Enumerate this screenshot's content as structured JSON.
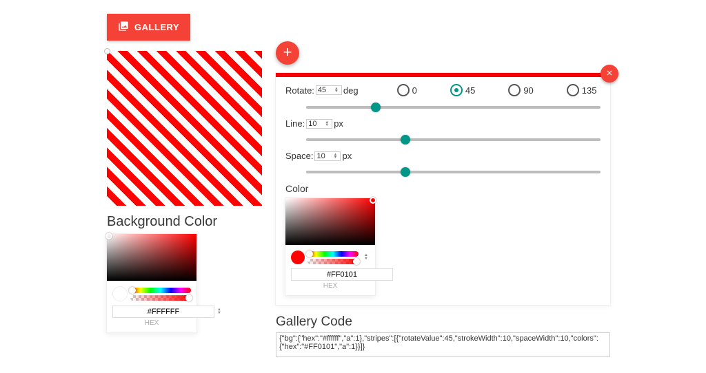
{
  "gallery_button_label": "GALLERY",
  "bg_section_title": "Background Color",
  "bg_hex": "#FFFFFF",
  "hex_label": "HEX",
  "fab_plus": "+",
  "rotate": {
    "label": "Rotate:",
    "value": "45",
    "unit": "deg",
    "options": [
      {
        "label": "0",
        "selected": false
      },
      {
        "label": "45",
        "selected": true
      },
      {
        "label": "90",
        "selected": false
      },
      {
        "label": "135",
        "selected": false
      }
    ]
  },
  "line": {
    "label": "Line:",
    "value": "10",
    "unit": "px"
  },
  "space": {
    "label": "Space:",
    "value": "10",
    "unit": "px"
  },
  "stripe_color_title": "Color",
  "stripe_hex": "#FF0101",
  "code_title": "Gallery Code",
  "code_value": "{\"bg\":{\"hex\":\"#ffffff\",\"a\":1},\"stripes\":[{\"rotateValue\":45,\"strokeWidth\":10,\"spaceWidth\":10,\"colors\":{\"hex\":\"#FF0101\",\"a\":1}}]}",
  "colors": {
    "accent": "#f44336",
    "teal": "#009688"
  }
}
